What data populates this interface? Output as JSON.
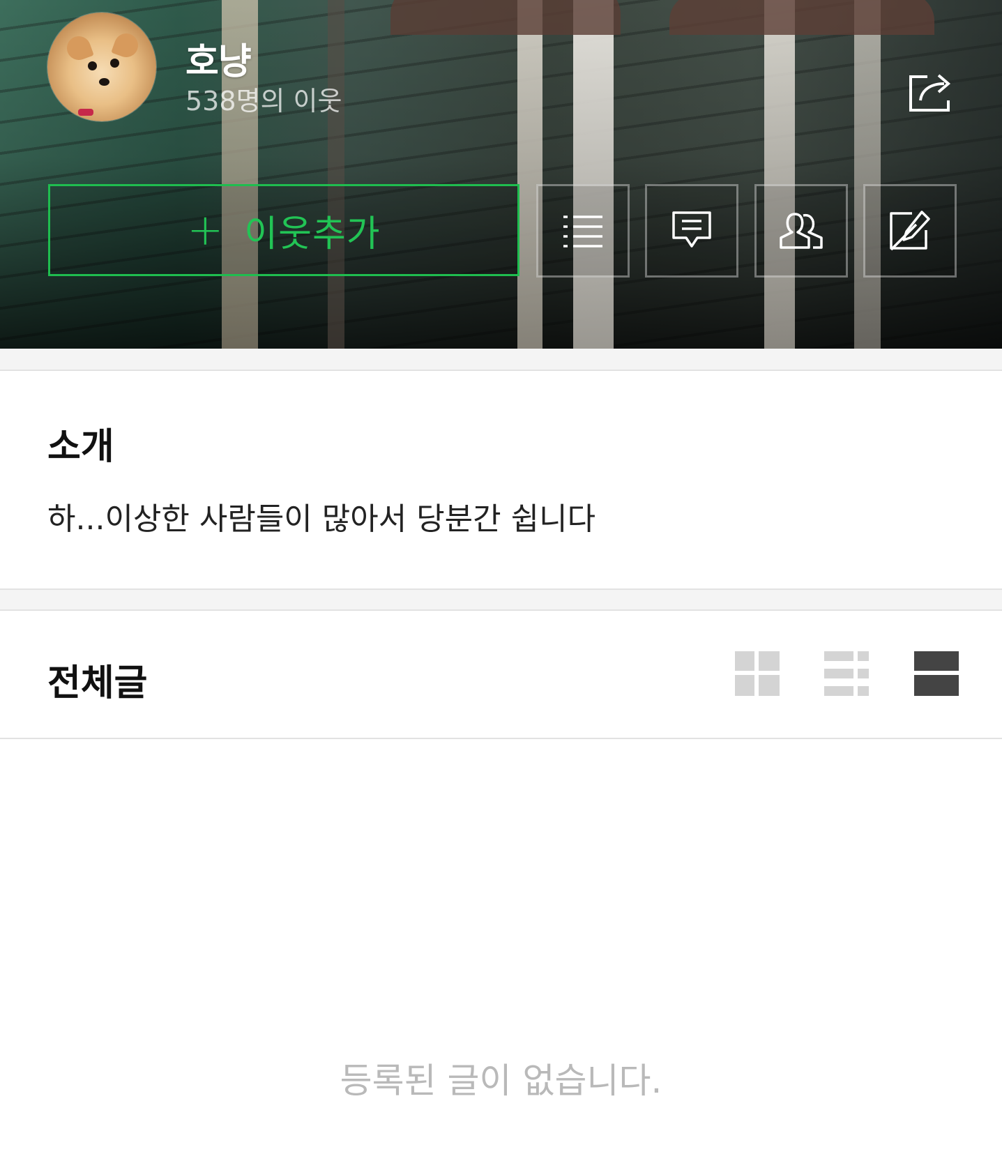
{
  "profile": {
    "blog_name": "호냥",
    "neighbor_count": "538명의 이웃",
    "avatar_icon": "profile-avatar",
    "share_icon": "share-icon"
  },
  "actions": {
    "add_neighbor_icon": "plus-icon",
    "add_neighbor_label": "이웃추가",
    "buttons": [
      {
        "name": "category-list-button",
        "icon": "list-icon"
      },
      {
        "name": "guestbook-button",
        "icon": "comment-icon"
      },
      {
        "name": "neighbors-button",
        "icon": "people-icon"
      },
      {
        "name": "write-button",
        "icon": "pen-icon"
      }
    ]
  },
  "intro": {
    "title": "소개",
    "text": "하...이상한 사람들이 많아서 당분간 쉽니다"
  },
  "posts": {
    "title": "전체글",
    "view_modes": [
      {
        "name": "grid-view",
        "icon": "grid-icon",
        "active": false
      },
      {
        "name": "list-view",
        "icon": "list-view-icon",
        "active": false
      },
      {
        "name": "card-view",
        "icon": "card-view-icon",
        "active": true
      }
    ],
    "empty_message": "등록된 글이 없습니다."
  },
  "colors": {
    "accent_green": "#22c455",
    "active_icon": "#444444",
    "inactive_icon": "#d4d4d4"
  }
}
